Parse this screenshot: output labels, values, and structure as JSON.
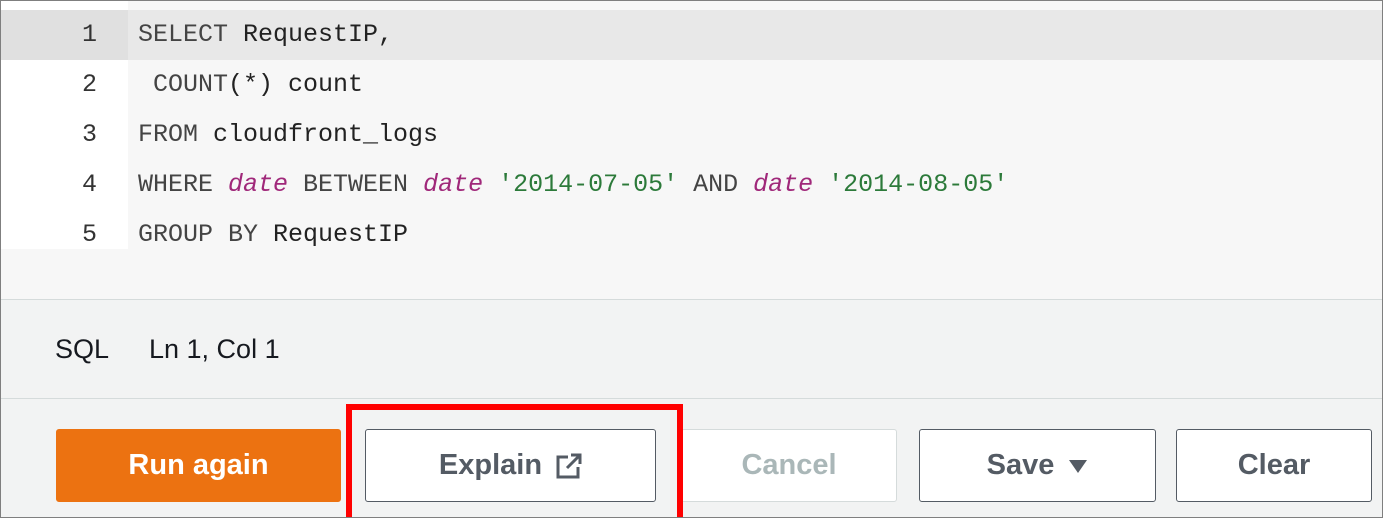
{
  "editor": {
    "lines": [
      {
        "number": "1",
        "tokens": [
          {
            "t": "SELECT",
            "c": "kw"
          },
          {
            "t": " RequestIP,",
            "c": "id"
          }
        ]
      },
      {
        "number": "2",
        "tokens": [
          {
            "t": " COUNT",
            "c": "fn"
          },
          {
            "t": "(*) count",
            "c": "id"
          }
        ]
      },
      {
        "number": "3",
        "tokens": [
          {
            "t": "FROM",
            "c": "kw"
          },
          {
            "t": " cloudfront_logs",
            "c": "id"
          }
        ]
      },
      {
        "number": "4",
        "tokens": [
          {
            "t": "WHERE ",
            "c": "kw"
          },
          {
            "t": "date",
            "c": "it"
          },
          {
            "t": " BETWEEN ",
            "c": "kw"
          },
          {
            "t": "date",
            "c": "it"
          },
          {
            "t": " ",
            "c": "id"
          },
          {
            "t": "'2014-07-05'",
            "c": "str"
          },
          {
            "t": " AND ",
            "c": "kw"
          },
          {
            "t": "date",
            "c": "it"
          },
          {
            "t": " ",
            "c": "id"
          },
          {
            "t": "'2014-08-05'",
            "c": "str"
          }
        ]
      },
      {
        "number": "5",
        "tokens": [
          {
            "t": "GROUP BY",
            "c": "kw"
          },
          {
            "t": " RequestIP",
            "c": "id"
          }
        ]
      }
    ]
  },
  "status": {
    "language": "SQL",
    "cursor": "Ln 1, Col 1"
  },
  "actions": {
    "run_again": "Run again",
    "explain": "Explain",
    "cancel": "Cancel",
    "save": "Save",
    "clear": "Clear"
  },
  "icons": {
    "explain": "external-link-icon",
    "save": "caret-down-icon"
  },
  "colors": {
    "primary_button": "#ec7211",
    "highlight_box": "#ff0000",
    "keyword_italic": "#a0287a",
    "string": "#2c7a3a"
  },
  "state": {
    "active_line": 1,
    "cancel_disabled": true,
    "highlighted_button": "explain"
  }
}
